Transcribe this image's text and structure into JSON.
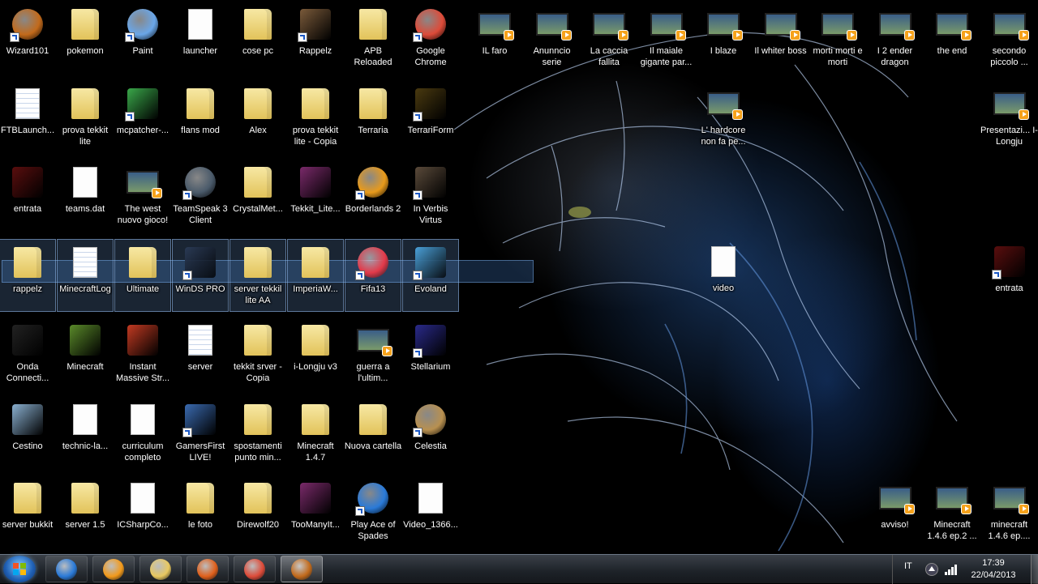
{
  "desktop": {
    "icons": [
      {
        "label": "Wizard101",
        "kind": "round",
        "color": "#c26a1b",
        "shortcut": true,
        "col": 0,
        "row": 0
      },
      {
        "label": "pokemon",
        "kind": "folder",
        "col": 1,
        "row": 0
      },
      {
        "label": "Paint",
        "kind": "round",
        "color": "#6aa6e8",
        "shortcut": true,
        "col": 2,
        "row": 0
      },
      {
        "label": "launcher",
        "kind": "doc",
        "col": 3,
        "row": 0
      },
      {
        "label": "cose pc",
        "kind": "folder",
        "col": 4,
        "row": 0
      },
      {
        "label": "Rappelz",
        "kind": "square",
        "color": "#7a5a3a",
        "shortcut": true,
        "col": 5,
        "row": 0
      },
      {
        "label": "APB Reloaded",
        "kind": "folder",
        "col": 6,
        "row": 0
      },
      {
        "label": "Google Chrome",
        "kind": "round",
        "color": "#dd4b39",
        "shortcut": true,
        "col": 7,
        "row": 0
      },
      {
        "label": "IL faro",
        "kind": "video",
        "col": 8,
        "row": 0
      },
      {
        "label": "Anunncio serie",
        "kind": "video",
        "col": 9,
        "row": 0
      },
      {
        "label": "La caccia fallita",
        "kind": "video",
        "col": 10,
        "row": 0
      },
      {
        "label": "Il maiale gigante par...",
        "kind": "video",
        "col": 11,
        "row": 0
      },
      {
        "label": "I blaze",
        "kind": "video",
        "col": 12,
        "row": 0
      },
      {
        "label": "Il whiter boss",
        "kind": "video",
        "col": 13,
        "row": 0
      },
      {
        "label": "morti morti e morti",
        "kind": "video",
        "col": 14,
        "row": 0
      },
      {
        "label": "I 2 ender dragon",
        "kind": "video",
        "col": 15,
        "row": 0
      },
      {
        "label": "the end",
        "kind": "video",
        "col": 16,
        "row": 0
      },
      {
        "label": "secondo piccolo ...",
        "kind": "video",
        "col": 17,
        "row": 0
      },
      {
        "label": "FTBLaunch...",
        "kind": "doclines",
        "col": 0,
        "row": 1
      },
      {
        "label": "prova tekkit lite",
        "kind": "folder",
        "col": 1,
        "row": 1
      },
      {
        "label": "mcpatcher-...",
        "kind": "square",
        "color": "#3aa84a",
        "shortcut": true,
        "col": 2,
        "row": 1
      },
      {
        "label": "flans mod",
        "kind": "folder",
        "col": 3,
        "row": 1
      },
      {
        "label": "Alex",
        "kind": "folder",
        "col": 4,
        "row": 1
      },
      {
        "label": "prova tekkit lite - Copia",
        "kind": "folder",
        "col": 5,
        "row": 1
      },
      {
        "label": "Terraria",
        "kind": "folder",
        "col": 6,
        "row": 1
      },
      {
        "label": "TerrariForm",
        "kind": "square",
        "color": "#4a3a10",
        "shortcut": true,
        "col": 7,
        "row": 1
      },
      {
        "label": "L' hardcore non fa pe...",
        "kind": "video",
        "col": 12,
        "row": 1
      },
      {
        "label": "Presentazi... I-Longju",
        "kind": "video",
        "col": 17,
        "row": 1
      },
      {
        "label": "entrata",
        "kind": "square",
        "color": "#5a0e0e",
        "col": 0,
        "row": 2
      },
      {
        "label": "teams.dat",
        "kind": "doc",
        "col": 1,
        "row": 2
      },
      {
        "label": "The west nuovo gioco!",
        "kind": "video",
        "col": 2,
        "row": 2
      },
      {
        "label": "TeamSpeak 3 Client",
        "kind": "round",
        "color": "#4a5a6a",
        "shortcut": true,
        "col": 3,
        "row": 2
      },
      {
        "label": "CrystalMet...",
        "kind": "folder",
        "col": 4,
        "row": 2
      },
      {
        "label": "Tekkit_Lite...",
        "kind": "square",
        "color": "#7a2a6a",
        "col": 5,
        "row": 2
      },
      {
        "label": "Borderlands 2",
        "kind": "round",
        "color": "#e89a1b",
        "shortcut": true,
        "col": 6,
        "row": 2
      },
      {
        "label": "In Verbis Virtus",
        "kind": "square",
        "color": "#5a4a3a",
        "shortcut": true,
        "col": 7,
        "row": 2
      },
      {
        "label": "rappelz",
        "kind": "folder",
        "col": 0,
        "row": 3,
        "selected": true
      },
      {
        "label": "MinecraftLog",
        "kind": "doclines",
        "col": 1,
        "row": 3,
        "selected": true
      },
      {
        "label": "Ultimate",
        "kind": "folder",
        "col": 2,
        "row": 3,
        "selected": true
      },
      {
        "label": "WinDS PRO",
        "kind": "square",
        "color": "#2a3a55",
        "shortcut": true,
        "col": 3,
        "row": 3,
        "selected": true
      },
      {
        "label": "server tekkil lite AA",
        "kind": "folder",
        "col": 4,
        "row": 3,
        "selected": true
      },
      {
        "label": "ImperiaW...",
        "kind": "folder",
        "col": 5,
        "row": 3,
        "selected": true
      },
      {
        "label": "Fifa13",
        "kind": "round",
        "color": "#e23a4a",
        "shortcut": true,
        "col": 6,
        "row": 3,
        "selected": true
      },
      {
        "label": "Evoland",
        "kind": "square",
        "color": "#4aa0d8",
        "shortcut": true,
        "col": 7,
        "row": 3,
        "selected": true
      },
      {
        "label": "video",
        "kind": "doc",
        "col": 12,
        "row": 3
      },
      {
        "label": "entrata",
        "kind": "square",
        "color": "#5a0e0e",
        "shortcut": true,
        "col": 17,
        "row": 3
      },
      {
        "label": "Onda Connecti...",
        "kind": "square",
        "color": "#222",
        "col": 0,
        "row": 4
      },
      {
        "label": "Minecraft",
        "kind": "square",
        "color": "#5a8a2a",
        "col": 1,
        "row": 4
      },
      {
        "label": "Instant Massive Str...",
        "kind": "square",
        "color": "#c23a22",
        "col": 2,
        "row": 4
      },
      {
        "label": "server",
        "kind": "doclines",
        "col": 3,
        "row": 4
      },
      {
        "label": "tekkit srver - Copia",
        "kind": "folder",
        "col": 4,
        "row": 4
      },
      {
        "label": "i-Longju v3",
        "kind": "folder",
        "col": 5,
        "row": 4
      },
      {
        "label": "guerra a l'ultim...",
        "kind": "video",
        "col": 6,
        "row": 4
      },
      {
        "label": "Stellarium",
        "kind": "square",
        "color": "#2a2a8a",
        "shortcut": true,
        "col": 7,
        "row": 4
      },
      {
        "label": "Cestino",
        "kind": "square",
        "color": "#8ab0d0",
        "col": 0,
        "row": 5
      },
      {
        "label": "technic-la...",
        "kind": "doc",
        "col": 1,
        "row": 5
      },
      {
        "label": "curriculum completo",
        "kind": "doc",
        "col": 2,
        "row": 5
      },
      {
        "label": "GamersFirst LIVE!",
        "kind": "square",
        "color": "#3a6ab0",
        "shortcut": true,
        "col": 3,
        "row": 5
      },
      {
        "label": "spostamenti punto min...",
        "kind": "folder",
        "col": 4,
        "row": 5
      },
      {
        "label": "Minecraft 1.4.7",
        "kind": "folder",
        "col": 5,
        "row": 5
      },
      {
        "label": "Nuova cartella",
        "kind": "folder",
        "col": 6,
        "row": 5
      },
      {
        "label": "Celestia",
        "kind": "round",
        "color": "#b89050",
        "shortcut": true,
        "col": 7,
        "row": 5
      },
      {
        "label": "server bukkit",
        "kind": "folder",
        "col": 0,
        "row": 6
      },
      {
        "label": "server 1.5",
        "kind": "folder",
        "col": 1,
        "row": 6
      },
      {
        "label": "ICSharpCo...",
        "kind": "doc",
        "col": 2,
        "row": 6
      },
      {
        "label": "le foto",
        "kind": "folder",
        "col": 3,
        "row": 6
      },
      {
        "label": "Direwolf20",
        "kind": "folder",
        "col": 4,
        "row": 6
      },
      {
        "label": "TooManyIt...",
        "kind": "square",
        "color": "#7a2a6a",
        "col": 5,
        "row": 6
      },
      {
        "label": "Play Ace of Spades",
        "kind": "round",
        "color": "#2a7ad8",
        "shortcut": true,
        "col": 6,
        "row": 6
      },
      {
        "label": "Video_1366...",
        "kind": "doc",
        "col": 7,
        "row": 6
      },
      {
        "label": "avviso!",
        "kind": "video",
        "col": 15,
        "row": 6
      },
      {
        "label": "Minecraft 1.4.6 ep.2 ...",
        "kind": "video",
        "col": 16,
        "row": 6
      },
      {
        "label": "minecraft 1.4.6 ep....",
        "kind": "video",
        "col": 17,
        "row": 6
      }
    ]
  },
  "taskbar": {
    "pinned": [
      {
        "name": "internet-explorer",
        "color": "#2a7ad8"
      },
      {
        "name": "media-player",
        "color": "#f39a1b"
      },
      {
        "name": "explorer",
        "color": "#e8c860"
      },
      {
        "name": "firefox",
        "color": "#e0601b"
      },
      {
        "name": "chrome",
        "color": "#dd4b39"
      },
      {
        "name": "wizard101",
        "color": "#c26a1b",
        "active": true
      }
    ],
    "tray": {
      "language": "IT",
      "time": "17:39",
      "date": "22/04/2013"
    }
  }
}
